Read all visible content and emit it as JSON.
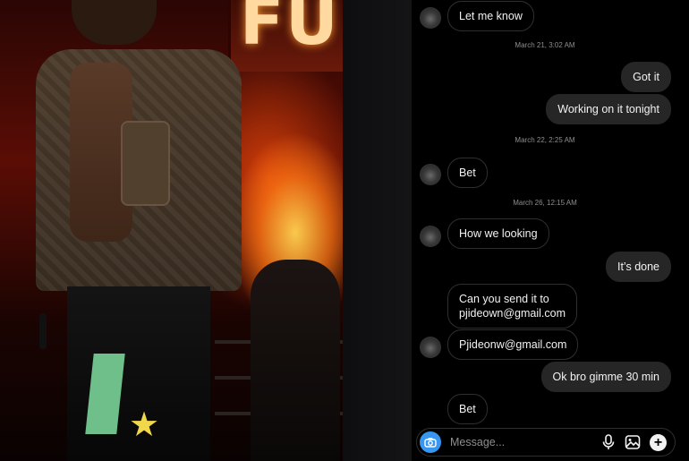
{
  "photo": {
    "sign_text": "FU"
  },
  "messages": [
    {
      "kind": "incoming",
      "text": "Let me know",
      "avatar": true
    },
    {
      "kind": "timestamp",
      "text": "March 21, 3:02 AM"
    },
    {
      "kind": "outgoing",
      "text": "Got it"
    },
    {
      "kind": "outgoing",
      "text": "Working on it tonight"
    },
    {
      "kind": "timestamp",
      "text": "March 22, 2:25 AM"
    },
    {
      "kind": "incoming",
      "text": "Bet",
      "avatar": true
    },
    {
      "kind": "timestamp",
      "text": "March 26, 12:15 AM"
    },
    {
      "kind": "incoming",
      "text": "How we looking",
      "avatar": true
    },
    {
      "kind": "outgoing",
      "text": "It’s done"
    },
    {
      "kind": "incoming",
      "text_line1": "Can you send it to",
      "text_line2": "pjideown@gmail.com",
      "avatar": false
    },
    {
      "kind": "incoming",
      "text": "Pjideonw@gmail.com",
      "avatar": true
    },
    {
      "kind": "outgoing",
      "text": "Ok bro gimme 30 min"
    },
    {
      "kind": "incoming",
      "text": "Bet",
      "avatar": false
    }
  ],
  "composer": {
    "placeholder": "Message...",
    "icons": [
      "camera-icon",
      "microphone-icon",
      "gallery-icon",
      "plus-icon"
    ],
    "camera_color": "#3797f0"
  },
  "colors": {
    "incoming_border": "#2f2f2f",
    "outgoing_bg": "#262626",
    "timestamp": "#8e8e8e"
  }
}
